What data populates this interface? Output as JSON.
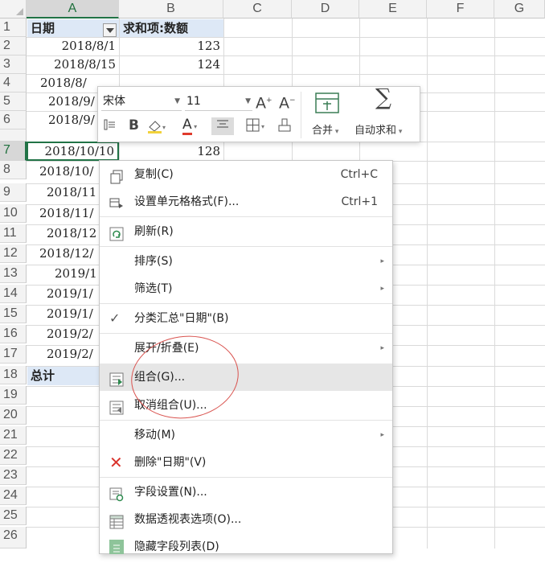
{
  "columns": [
    "A",
    "B",
    "C",
    "D",
    "E",
    "F",
    "G"
  ],
  "rows": [
    "1",
    "2",
    "3",
    "4",
    "5",
    "6",
    "7",
    "8",
    "9",
    "10",
    "11",
    "12",
    "13",
    "14",
    "15",
    "16",
    "17",
    "18",
    "19",
    "20",
    "21",
    "22",
    "23",
    "24",
    "25",
    "26"
  ],
  "sheet": {
    "header_a": "日期",
    "header_b": "求和项:数额",
    "total_label": "总计",
    "col_a": [
      "2018/8/1",
      "2018/8/15",
      "2018/8/",
      "2018/9/",
      "2018/9/",
      "2018/10/10",
      "2018/10/",
      "2018/11",
      "2018/11/",
      "2018/12",
      "2018/12/",
      "2019/1",
      "2019/1/",
      "2019/1/",
      "2019/2/",
      "2019/2/"
    ],
    "col_b": [
      "123",
      "124",
      "",
      "",
      "",
      "128"
    ]
  },
  "mini_toolbar": {
    "font_name": "宋体",
    "font_size": "11",
    "merge_label": "合并",
    "autosum_label": "自动求和",
    "bold_glyph": "B",
    "font_color_glyph": "A",
    "grow_glyph": "A",
    "shrink_glyph": "A"
  },
  "context_menu": {
    "copy": "复制(C)",
    "copy_shortcut": "Ctrl+C",
    "format_cells": "设置单元格格式(F)...",
    "format_cells_shortcut": "Ctrl+1",
    "refresh": "刷新(R)",
    "sort": "排序(S)",
    "filter": "筛选(T)",
    "subtotal": "分类汇总\"日期\"(B)",
    "expand_collapse": "展开/折叠(E)",
    "group": "组合(G)...",
    "ungroup": "取消组合(U)...",
    "move": "移动(M)",
    "delete": "删除\"日期\"(V)",
    "field_settings": "字段设置(N)...",
    "pivot_options": "数据透视表选项(O)...",
    "hide_field_list": "隐藏字段列表(D)"
  },
  "colors": {
    "accent": "#217346",
    "pivot_header": "#dde8f6",
    "highlight_ellipse": "#d9534f"
  }
}
